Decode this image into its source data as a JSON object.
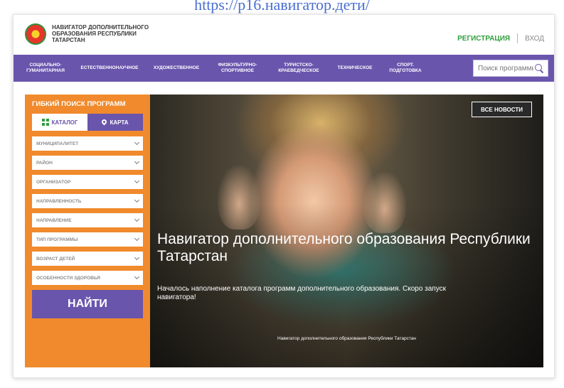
{
  "url_caption": "https://р16.навигатор.дети/",
  "header": {
    "logo_line1": "Навигатор дополнительного",
    "logo_line2": "образования Республики",
    "logo_line3": "Татарстан",
    "register_label": "Регистрация",
    "login_label": "Вход"
  },
  "nav": {
    "items": [
      {
        "line1": "Социально-",
        "line2": "гуманитарная"
      },
      {
        "line1": "Естественнонаучное",
        "line2": ""
      },
      {
        "line1": "Художественное",
        "line2": ""
      },
      {
        "line1": "Физкультурно-",
        "line2": "спортивное"
      },
      {
        "line1": "Туристско-",
        "line2": "краеведческое"
      },
      {
        "line1": "Техническое",
        "line2": ""
      },
      {
        "line1": "Спорт.",
        "line2": "подготовка"
      }
    ],
    "search_placeholder": "Поиск программы..."
  },
  "sidebar": {
    "title": "Гибкий поиск программ",
    "tab_catalog": "Каталог",
    "tab_map": "Карта",
    "filters": [
      "Муниципалитет",
      "Район",
      "Организатор",
      "Направленность",
      "Направление",
      "Тип программы",
      "Возраст детей",
      "Особенности здоровья"
    ],
    "find_label": "Найти"
  },
  "hero": {
    "all_news_label": "Все новости",
    "title": "Навигатор дополнительного образования Республики Татарстан",
    "text": "Началось наполнение каталога программ дополнительного образования. Скоро запуск навигатора!",
    "caption": "Навигатор дополнительного образования Республики Татарстан"
  },
  "colors": {
    "nav_purple": "#6a55ad",
    "sidebar_orange": "#f08a2c",
    "register_green": "#2f9e3e"
  }
}
